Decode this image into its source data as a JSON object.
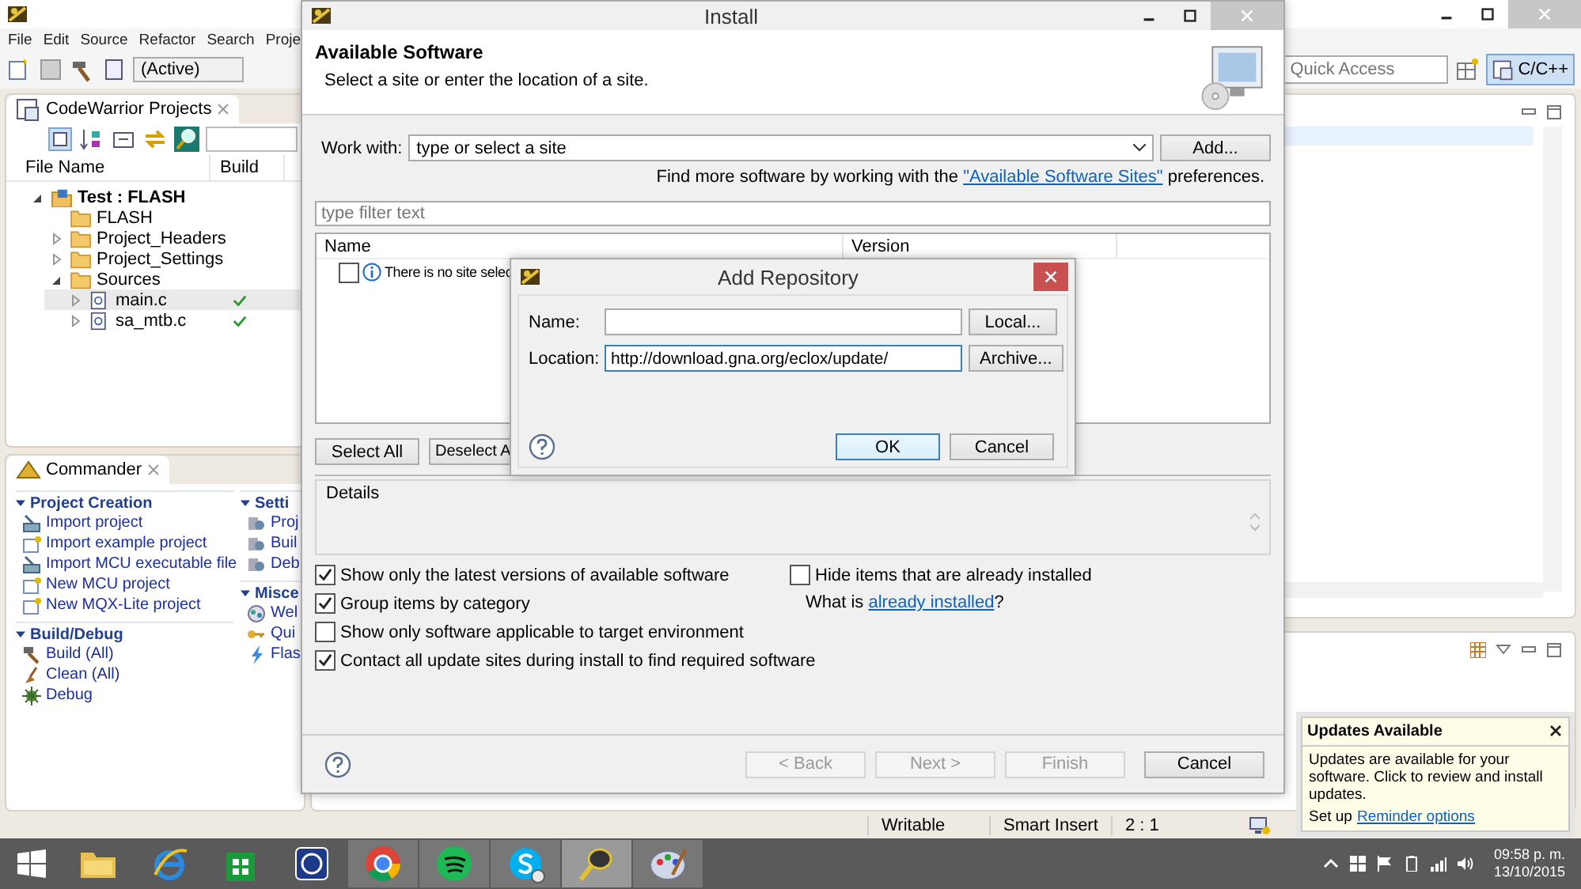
{
  "ide": {
    "menu": [
      "File",
      "Edit",
      "Source",
      "Refactor",
      "Search",
      "Proje"
    ],
    "toolbar": {
      "config": "(Active)"
    },
    "quick_access": {
      "placeholder": "Quick Access"
    },
    "perspective": {
      "label": "C/C++",
      "selected": true
    },
    "projects_view": {
      "title": "CodeWarrior Projects",
      "columns": [
        "File Name",
        "Build"
      ],
      "tree": [
        {
          "label": "Test : FLASH",
          "kind": "project",
          "expanded": true,
          "selected": false,
          "children": [
            {
              "label": "FLASH",
              "kind": "folder",
              "selected": false
            },
            {
              "label": "Project_Headers",
              "kind": "folder",
              "expanded": false,
              "selected": false
            },
            {
              "label": "Project_Settings",
              "kind": "folder",
              "expanded": false,
              "selected": false
            },
            {
              "label": "Sources",
              "kind": "folder",
              "expanded": true,
              "selected": false,
              "children": [
                {
                  "label": "main.c",
                  "kind": "file",
                  "expanded": false,
                  "selected": true,
                  "built": true
                },
                {
                  "label": "sa_mtb.c",
                  "kind": "file",
                  "expanded": false,
                  "selected": false,
                  "built": true
                }
              ]
            }
          ]
        }
      ]
    },
    "commander": {
      "title": "Commander",
      "columns": [
        [
          {
            "title": "Project Creation",
            "expanded": true,
            "items": [
              {
                "label": "Import project",
                "kind": "import"
              },
              {
                "label": "Import example project",
                "kind": "new"
              },
              {
                "label": "Import MCU executable file",
                "kind": "import"
              },
              {
                "label": "New MCU project",
                "kind": "new"
              },
              {
                "label": "New MQX-Lite project",
                "kind": "new"
              }
            ]
          },
          {
            "title": "Build/Debug",
            "expanded": true,
            "items": [
              {
                "label": "Build   (All)",
                "kind": "build"
              },
              {
                "label": "Clean   (All)",
                "kind": "clean"
              },
              {
                "label": "Debug",
                "kind": "debug"
              }
            ]
          }
        ],
        [
          {
            "title": "Setti",
            "expanded": true,
            "items": [
              {
                "label": "Proj",
                "kind": "settings"
              },
              {
                "label": "Buil",
                "kind": "settings"
              },
              {
                "label": "Deb",
                "kind": "settings"
              }
            ]
          },
          {
            "title": "Misce",
            "expanded": true,
            "items": [
              {
                "label": "Wel",
                "kind": "welcome"
              },
              {
                "label": "Qui",
                "kind": "key"
              },
              {
                "label": "Flas",
                "kind": "flash"
              }
            ]
          }
        ]
      ]
    },
    "status_bar": [
      "Writable",
      "Smart Insert",
      "2 : 1"
    ]
  },
  "install_dialog": {
    "title": "Install",
    "header_title": "Available Software",
    "header_subtitle": "Select a site or enter the location of a site.",
    "work_with": {
      "label": "Work with:",
      "placeholder": "type or select a site",
      "button": "Add..."
    },
    "find_more": {
      "text": "Find more software by working with the",
      "link": "\"Available Software Sites\"",
      "after": "preferences."
    },
    "filter": {
      "placeholder": "type filter text"
    },
    "columns": [
      "Name",
      "Version"
    ],
    "rows": [
      {
        "label": "There is no site selec",
        "checked": false
      }
    ],
    "list_buttons": [
      "Select All",
      "Deselect A"
    ],
    "details": {
      "label": "Details"
    },
    "options": [
      {
        "label": "Show only the latest versions of available software",
        "checked": true
      },
      {
        "label": "Group items by category",
        "checked": true
      },
      {
        "label": "Show only software applicable to target environment",
        "checked": false
      },
      {
        "label": "Contact all update sites during install to find required software",
        "checked": true
      }
    ],
    "hide_option": {
      "label": "Hide items that are already installed",
      "checked": false
    },
    "what_is": {
      "text": "What is",
      "link": "already installed",
      "after": "?"
    },
    "buttons": [
      {
        "label": "< Back",
        "disabled": true
      },
      {
        "label": "Next >",
        "disabled": true
      },
      {
        "label": "Finish",
        "disabled": true
      },
      {
        "label": "Cancel",
        "disabled": false
      }
    ]
  },
  "add_repository": {
    "title": "Add Repository",
    "fields": [
      {
        "label": "Name:",
        "button": "Local...",
        "focused": false
      },
      {
        "label": "Location:",
        "value": "http://download.gna.org/eclox/update/",
        "button": "Archive...",
        "focused": true
      }
    ],
    "buttons": [
      {
        "label": "OK",
        "default": true
      },
      {
        "label": "Cancel",
        "default": false
      }
    ]
  },
  "notification": {
    "title": "Updates Available",
    "body": "Updates are available for your software. Click to review and install updates.",
    "setup": "Set up",
    "link": "Reminder options"
  },
  "taskbar": {
    "apps": [
      {
        "kind": "folder",
        "running": false,
        "selected": false
      },
      {
        "kind": "browser-e",
        "running": false,
        "selected": false
      },
      {
        "kind": "store",
        "running": false,
        "selected": false
      },
      {
        "kind": "help",
        "running": false,
        "selected": false
      },
      {
        "kind": "chrome",
        "running": true,
        "selected": false
      },
      {
        "kind": "spotify",
        "running": true,
        "selected": false
      },
      {
        "kind": "skype",
        "running": true,
        "selected": false
      },
      {
        "kind": "eclipse",
        "running": true,
        "selected": true
      },
      {
        "kind": "paint",
        "running": true,
        "selected": false
      }
    ],
    "time": "09:58 p. m.",
    "date": "13/10/2015"
  }
}
